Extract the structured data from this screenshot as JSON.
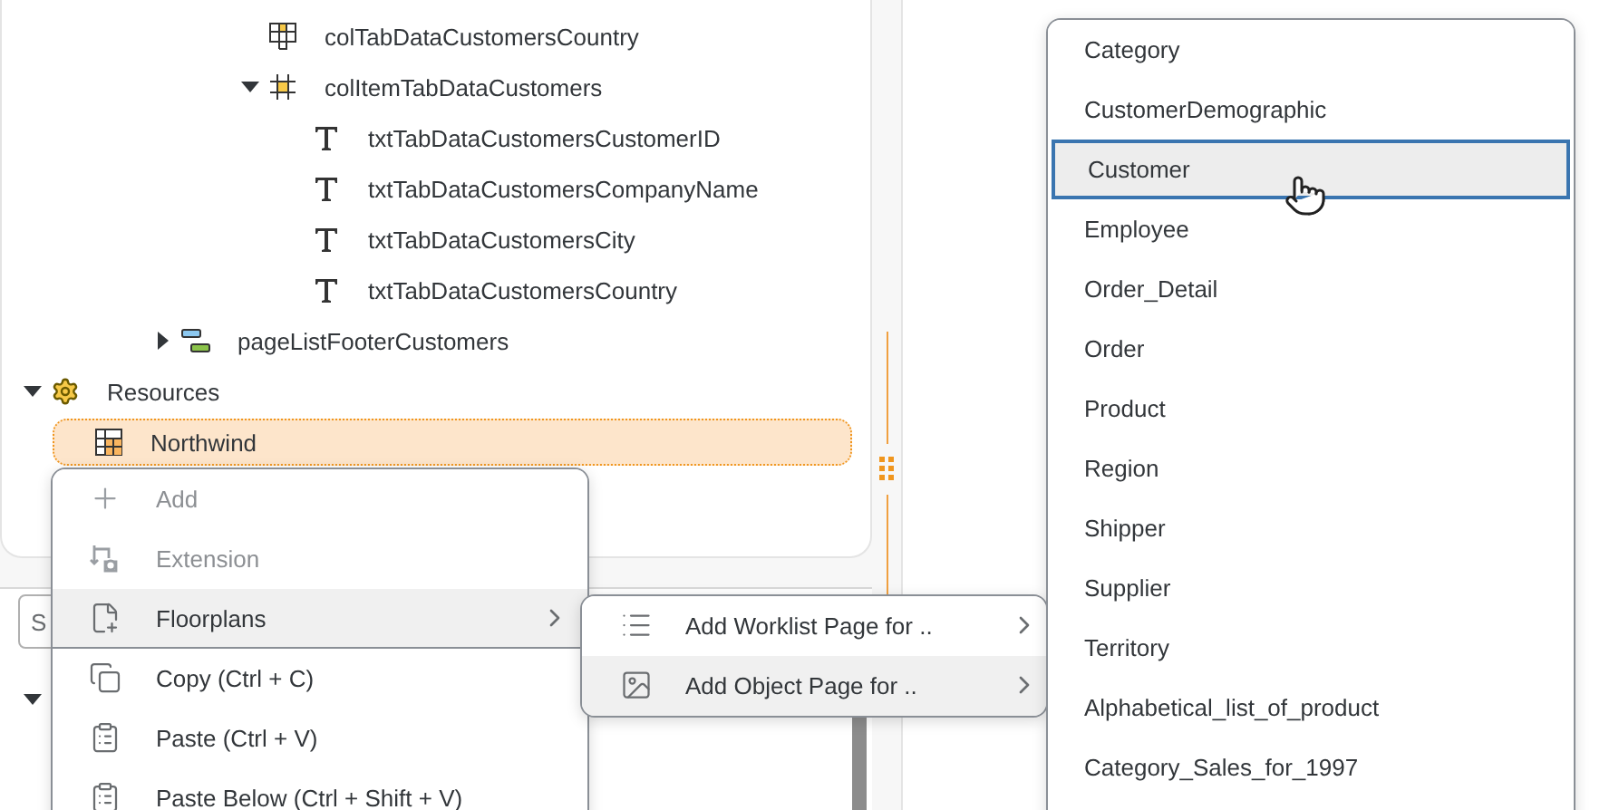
{
  "tree": [
    {
      "children": [
        {
          "children": [
            {
              "children": [
                {
                  "children": [
                    {
                      "children": [
                        {
                          "label": "colTabDataCustomersCountry",
                          "kind": "table",
                          "selected": false
                        },
                        {
                          "label": "colItemTabDataCustomers",
                          "kind": "column-list",
                          "expanded": true,
                          "selected": false,
                          "children": [
                            {
                              "label": "txtTabDataCustomersCustomerID",
                              "kind": "text",
                              "selected": false
                            },
                            {
                              "label": "txtTabDataCustomersCompanyName",
                              "kind": "text",
                              "selected": false
                            },
                            {
                              "label": "txtTabDataCustomersCity",
                              "kind": "text",
                              "selected": false
                            },
                            {
                              "label": "txtTabDataCustomersCountry",
                              "kind": "text",
                              "selected": false
                            }
                          ]
                        }
                      ]
                    }
                  ]
                },
                {
                  "label": "pageListFooterCustomers",
                  "kind": "footer",
                  "expanded": false,
                  "selected": false
                }
              ]
            }
          ]
        }
      ]
    },
    {
      "label": "Resources",
      "kind": "resources",
      "expanded": true,
      "selected": false,
      "children": [
        {
          "label": "Northwind",
          "kind": "data-source",
          "selected": true
        }
      ]
    }
  ],
  "lower_panel": {
    "search": {
      "placeholder": "S"
    }
  },
  "context_menu": [
    {
      "label": "Add",
      "kind": "add",
      "disabled": true,
      "selected": false,
      "has_submenu": false,
      "separator_after": false
    },
    {
      "label": "Extension",
      "kind": "extension",
      "disabled": true,
      "selected": false,
      "has_submenu": false,
      "separator_after": false
    },
    {
      "label": "Floorplans",
      "kind": "floorplans",
      "disabled": false,
      "selected": true,
      "has_submenu": true,
      "separator_after": true
    },
    {
      "label": "Copy (Ctrl + C)",
      "kind": "copy",
      "disabled": false,
      "selected": false,
      "has_submenu": false,
      "separator_after": false
    },
    {
      "label": "Paste (Ctrl + V)",
      "kind": "paste",
      "disabled": false,
      "selected": false,
      "has_submenu": false,
      "separator_after": false
    },
    {
      "label": "Paste Below (Ctrl + Shift + V)",
      "kind": "paste",
      "disabled": false,
      "selected": false,
      "has_submenu": false
    }
  ],
  "submenu": [
    {
      "label": "Add Worklist Page for ..",
      "kind": "list",
      "selected": false
    },
    {
      "label": "Add Object Page for ..",
      "kind": "object",
      "selected": true
    }
  ],
  "entity_list": [
    {
      "label": "Category",
      "selected": false
    },
    {
      "label": "CustomerDemographic",
      "selected": false
    },
    {
      "label": "Customer",
      "selected": true
    },
    {
      "label": "Employee",
      "selected": false
    },
    {
      "label": "Order_Detail",
      "selected": false
    },
    {
      "label": "Order",
      "selected": false
    },
    {
      "label": "Product",
      "selected": false
    },
    {
      "label": "Region",
      "selected": false
    },
    {
      "label": "Shipper",
      "selected": false
    },
    {
      "label": "Supplier",
      "selected": false
    },
    {
      "label": "Territory",
      "selected": false
    },
    {
      "label": "Alphabetical_list_of_product",
      "selected": false
    },
    {
      "label": "Category_Sales_for_1997",
      "selected": false
    }
  ]
}
